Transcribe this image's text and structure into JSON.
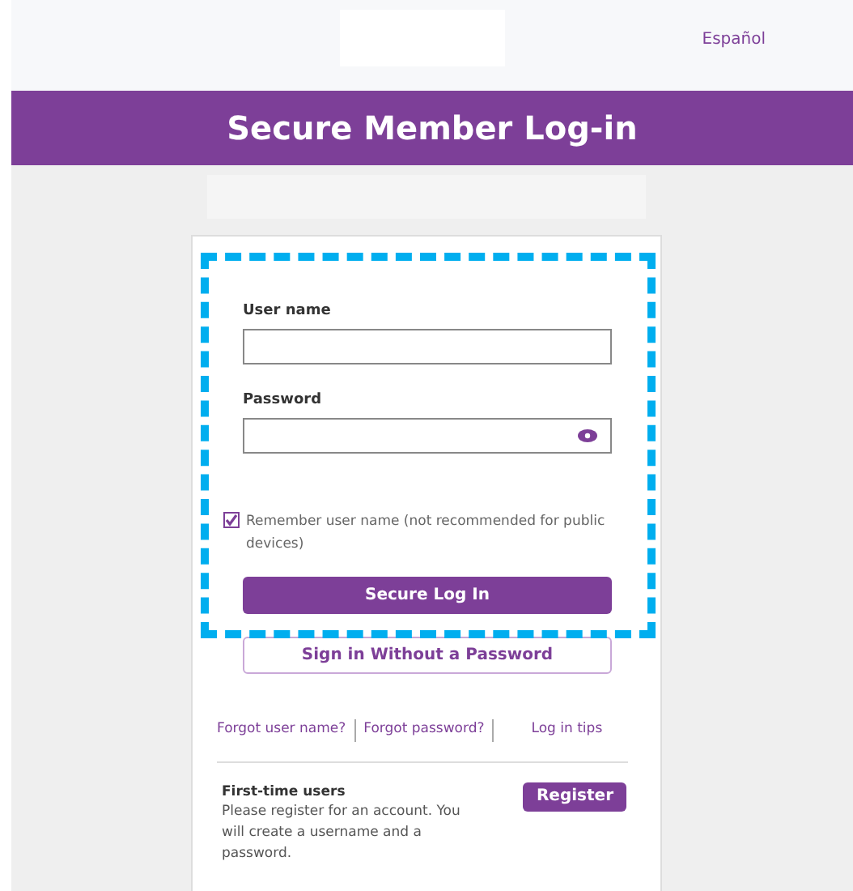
{
  "header": {
    "language_link": "Español"
  },
  "banner": {
    "title": "Secure Member Log-in"
  },
  "form": {
    "username": {
      "label": "User name"
    },
    "password": {
      "label": "Password"
    },
    "remember": {
      "label": "Remember user name (not recommended for public devices)",
      "checked": true
    },
    "login_button": "Secure Log In",
    "passwordless_button": "Sign in Without a Password"
  },
  "links": [
    "Forgot user name?",
    "Forgot password?",
    "Log in tips"
  ],
  "first_time": {
    "title": "First-time users",
    "text": "Please register for an account. You will create a username and a password.",
    "button": "Register"
  }
}
